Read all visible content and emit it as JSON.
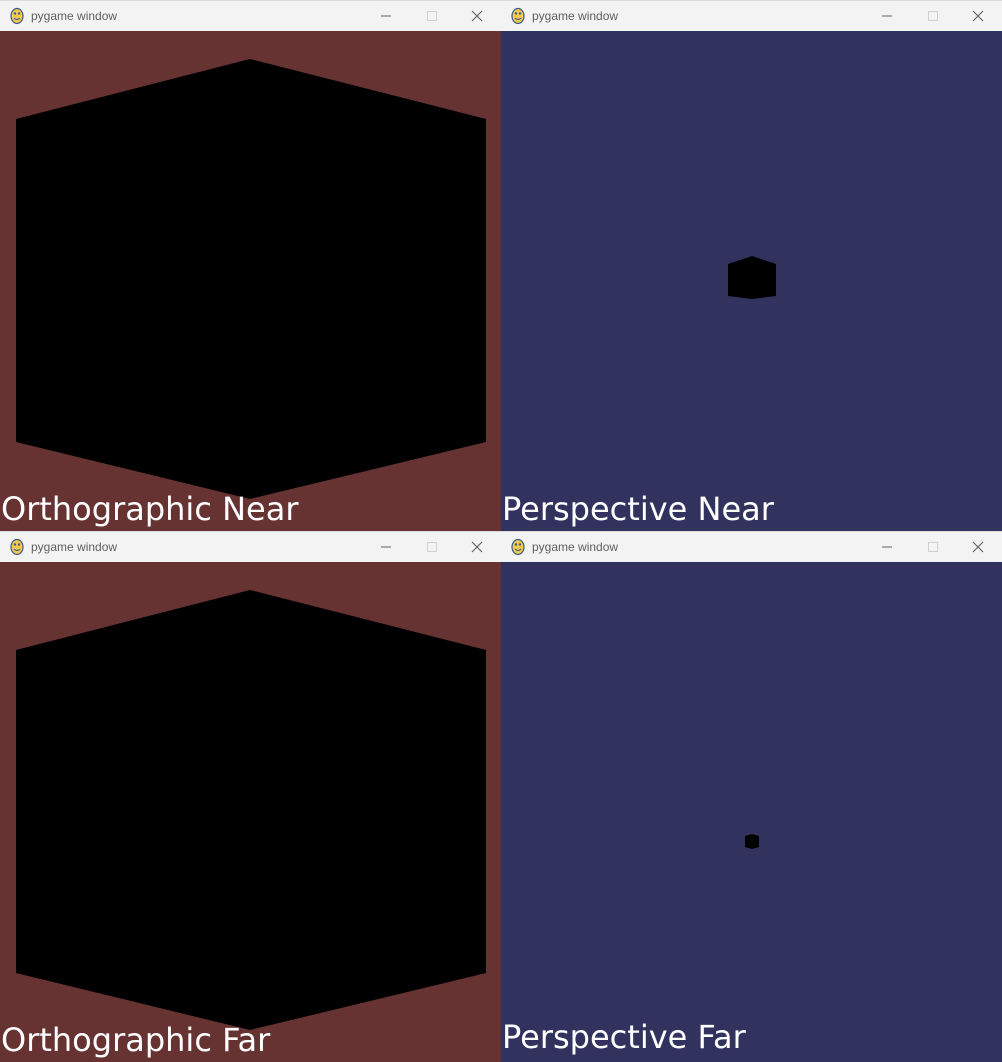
{
  "windows": [
    {
      "title": "pygame window",
      "label": "Orthographic Near",
      "background": "#673232",
      "shape_color": "#000000",
      "icon": "pygame-snake-icon"
    },
    {
      "title": "pygame window",
      "label": "Perspective Near",
      "background": "#32325f",
      "shape_color": "#000000",
      "icon": "pygame-snake-icon"
    },
    {
      "title": "pygame window",
      "label": "Orthographic Far",
      "background": "#673232",
      "shape_color": "#000000",
      "icon": "pygame-snake-icon"
    },
    {
      "title": "pygame window",
      "label": "Perspective Far",
      "background": "#32325f",
      "shape_color": "#000000",
      "icon": "pygame-snake-icon"
    }
  ],
  "controls": {
    "minimize": "minimize-icon",
    "maximize": "maximize-icon",
    "close": "close-icon"
  }
}
